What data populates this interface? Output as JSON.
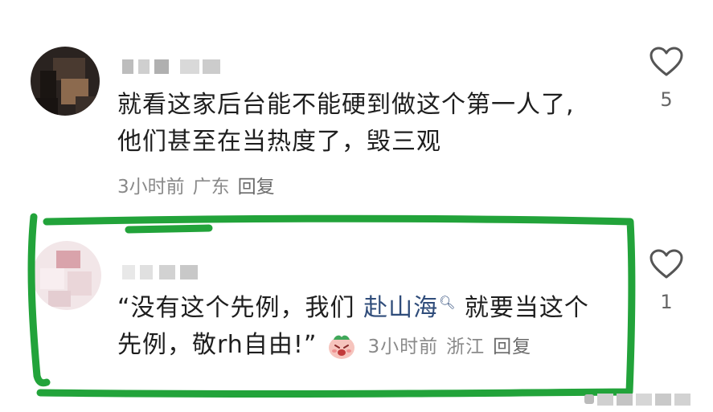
{
  "comments": [
    {
      "text_lines": [
        "就看这家后台能不能硬到做这个第一人了,",
        "他们甚至在当热度了，毁三观"
      ],
      "time": "3小时前",
      "location": "广东",
      "reply_label": "回复",
      "like_count": "5"
    },
    {
      "quote_open": "“没有这个先例，我们 ",
      "hashtag": "赴山海",
      "hashtag_icon": "search-icon",
      "quote_rest": " 就要当这个",
      "line2": "先例，敬rh自由!”",
      "emoji": "crying-face-emoji",
      "time": "3小时前",
      "location": "浙江",
      "reply_label": "回复",
      "like_count": "1"
    }
  ],
  "highlight_color": "#22a33a"
}
